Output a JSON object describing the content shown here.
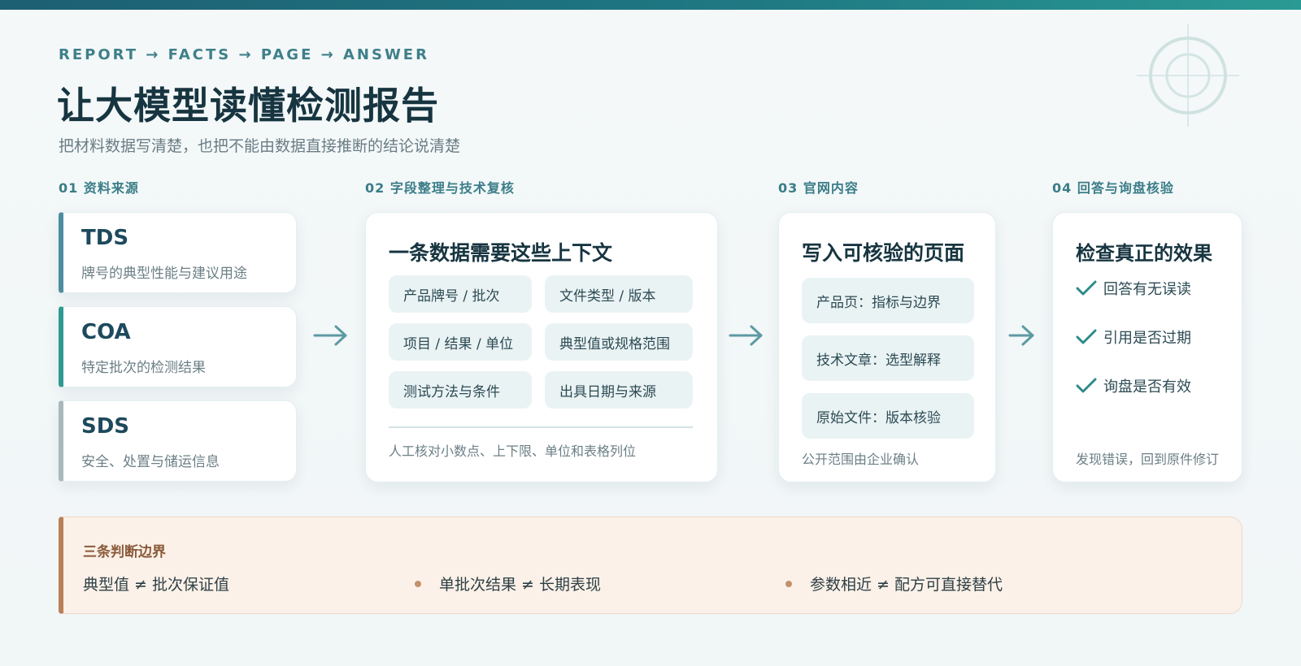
{
  "header": {
    "kicker": "REPORT → FACTS → PAGE → ANSWER",
    "title": "让大模型读懂检测报告",
    "subtitle": "把材料数据写清楚，也把不能由数据直接推断的结论说清楚"
  },
  "columns": {
    "sources": {
      "label": "01 资料来源",
      "items": [
        {
          "name": "TDS",
          "desc": "牌号的典型性能与建议用途",
          "accent": "#4d8da0"
        },
        {
          "name": "COA",
          "desc": "特定批次的检测结果",
          "accent": "#2f9a92"
        },
        {
          "name": "SDS",
          "desc": "安全、处置与储运信息",
          "accent": "#a8b8bd"
        }
      ]
    },
    "fields": {
      "label": "02 字段整理与技术复核",
      "heading": "一条数据需要这些上下文",
      "chips": [
        "产品牌号 / 批次",
        "文件类型 / 版本",
        "项目 / 结果 / 单位",
        "典型值或规格范围",
        "测试方法与条件",
        "出具日期与来源"
      ],
      "note": "人工核对小数点、上下限、单位和表格列位"
    },
    "website": {
      "label": "03 官网内容",
      "heading": "写入可核验的页面",
      "chips": [
        "产品页：指标与边界",
        "技术文章：选型解释",
        "原始文件：版本核验"
      ],
      "note": "公开范围由企业确认"
    },
    "verify": {
      "label": "04 回答与询盘核验",
      "heading": "检查真正的效果",
      "checks": [
        "回答有无误读",
        "引用是否过期",
        "询盘是否有效"
      ],
      "note": "发现错误，回到原件修订"
    }
  },
  "boundary": {
    "heading": "三条判断边界",
    "items": [
      "典型值 ≠ 批次保证值",
      "单批次结果 ≠ 长期表现",
      "参数相近 ≠ 配方可直接替代"
    ]
  },
  "colors": {
    "accent": "#3f7f8a",
    "check": "#2f8a8a",
    "boundary_accent": "#b98058"
  },
  "icons": [
    "target-icon",
    "arrow-right-icon",
    "check-icon"
  ]
}
